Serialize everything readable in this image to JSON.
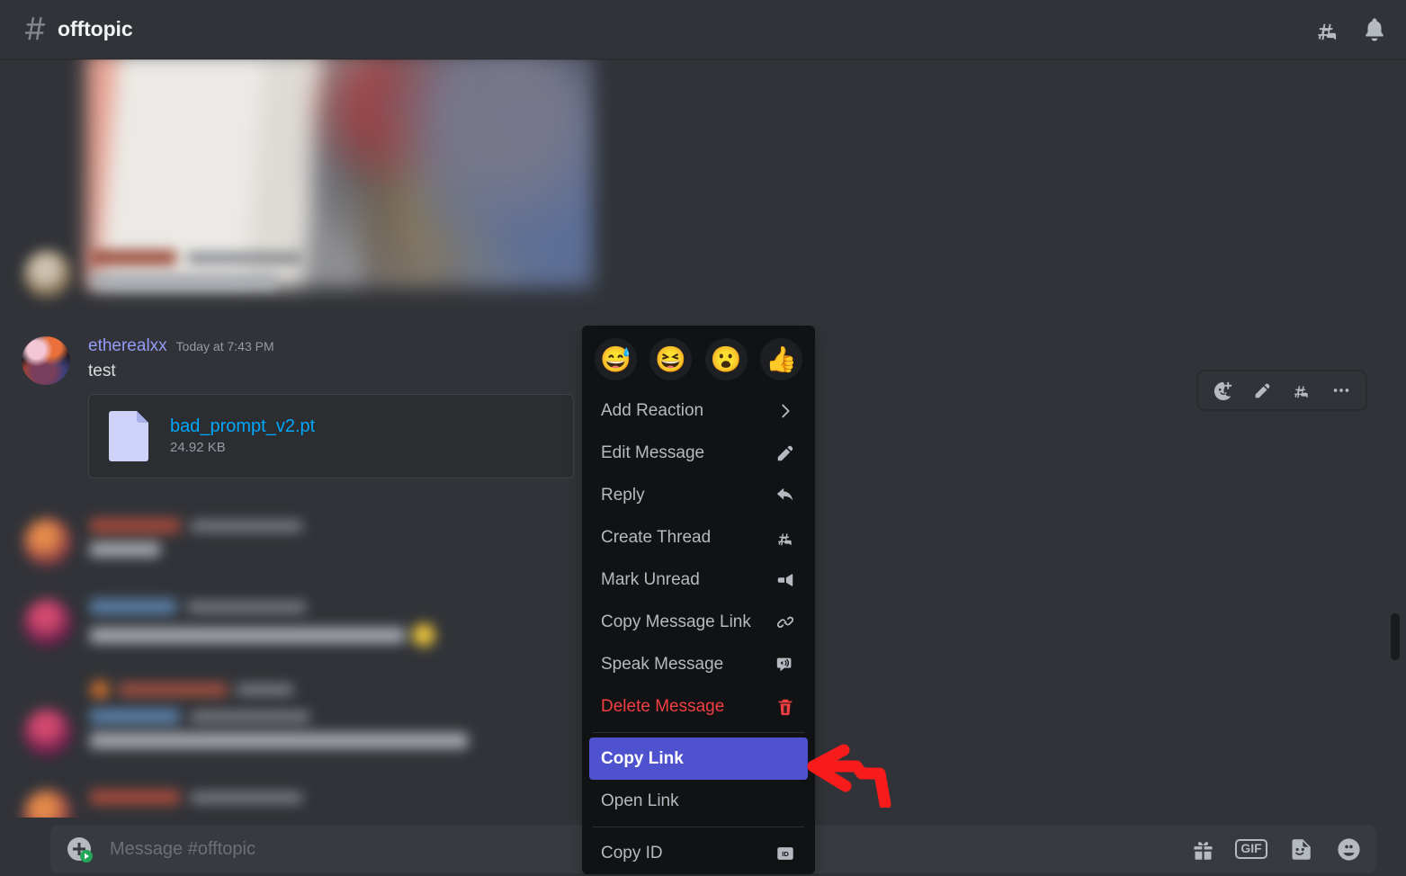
{
  "header": {
    "channel_name": "offtopic",
    "hash_icon": "hash-icon",
    "threads_icon": "threads-icon",
    "notifications_icon": "bell-icon"
  },
  "message": {
    "author": "etherealxx",
    "timestamp": "Today at 7:43 PM",
    "text": "test",
    "attachment": {
      "file_name": "bad_prompt_v2.pt",
      "file_size": "24.92 KB"
    }
  },
  "hover_toolbar": {
    "buttons": [
      {
        "name": "add-reaction-icon",
        "title": "Add Reaction"
      },
      {
        "name": "edit-icon",
        "title": "Edit"
      },
      {
        "name": "create-thread-icon",
        "title": "Create Thread"
      },
      {
        "name": "more-icon",
        "title": "More"
      }
    ]
  },
  "context_menu": {
    "quick_reactions": [
      {
        "name": "sweat-smile-emoji",
        "glyph": "😅"
      },
      {
        "name": "laughing-emoji",
        "glyph": "😆"
      },
      {
        "name": "open-mouth-emoji",
        "glyph": "😮"
      },
      {
        "name": "thumbs-up-emoji",
        "glyph": "👍"
      }
    ],
    "items": [
      {
        "label": "Add Reaction",
        "icon": "chevron-right-icon",
        "style": "normal",
        "name": "menu-item-add-reaction"
      },
      {
        "label": "Edit Message",
        "icon": "pencil-icon",
        "style": "normal",
        "name": "menu-item-edit-message"
      },
      {
        "label": "Reply",
        "icon": "reply-arrow-icon",
        "style": "normal",
        "name": "menu-item-reply"
      },
      {
        "label": "Create Thread",
        "icon": "thread-icon",
        "style": "normal",
        "name": "menu-item-create-thread"
      },
      {
        "label": "Mark Unread",
        "icon": "mark-unread-icon",
        "style": "normal",
        "name": "menu-item-mark-unread"
      },
      {
        "label": "Copy Message Link",
        "icon": "link-icon",
        "style": "normal",
        "name": "menu-item-copy-message-link"
      },
      {
        "label": "Speak Message",
        "icon": "speaker-icon",
        "style": "normal",
        "name": "menu-item-speak-message"
      },
      {
        "label": "Delete Message",
        "icon": "trash-icon",
        "style": "danger",
        "name": "menu-item-delete-message"
      },
      {
        "label": "Copy Link",
        "icon": "none",
        "style": "selected",
        "name": "menu-item-copy-link"
      },
      {
        "label": "Open Link",
        "icon": "none",
        "style": "normal",
        "name": "menu-item-open-link"
      },
      {
        "label": "Copy ID",
        "icon": "id-badge-icon",
        "style": "normal",
        "name": "menu-item-copy-id"
      }
    ]
  },
  "composer": {
    "placeholder": "Message #offtopic",
    "attach_icon": "attach-plus-icon",
    "icons": [
      {
        "name": "gift-icon",
        "label": ""
      },
      {
        "name": "gif-icon",
        "label": "GIF"
      },
      {
        "name": "sticker-icon",
        "label": ""
      },
      {
        "name": "emoji-icon",
        "label": ""
      }
    ]
  },
  "annotation": {
    "arrow_color": "#f71b1b",
    "points_at": "Copy Link"
  },
  "colors": {
    "background": "#313338",
    "menu_background": "#111214",
    "selected": "#4e52cf",
    "danger": "#f23f42",
    "link": "#00a8fc",
    "author": "#949cf7"
  }
}
